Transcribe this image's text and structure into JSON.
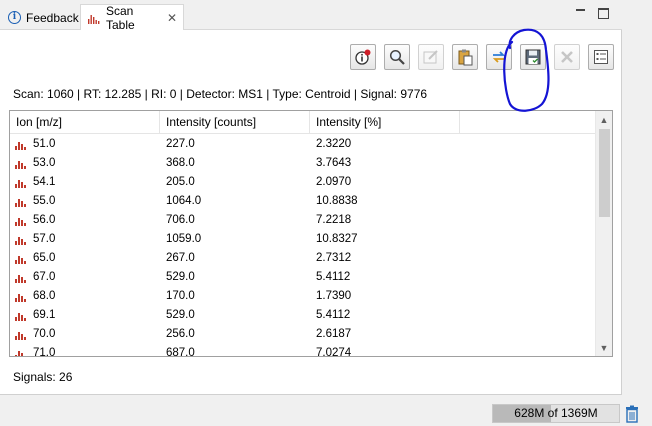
{
  "tabs": [
    {
      "label": "Feedback",
      "icon": "info-icon",
      "active": false
    },
    {
      "label": "Scan Table",
      "icon": "chart-bars-icon",
      "active": true,
      "closable": true
    }
  ],
  "window_controls": {
    "minimize_icon": "minimize-icon",
    "maximize_icon": "maximize-icon"
  },
  "toolbar": [
    {
      "name": "info-button",
      "icon": "info-badge-icon",
      "enabled": true
    },
    {
      "name": "search-button",
      "icon": "magnifier-icon",
      "enabled": true
    },
    {
      "name": "edit-button",
      "icon": "pencil-icon",
      "enabled": false
    },
    {
      "name": "paste-button",
      "icon": "clipboard-icon",
      "enabled": true
    },
    {
      "name": "sync-button",
      "icon": "swap-arrows-icon",
      "enabled": true
    },
    {
      "name": "save-button",
      "icon": "floppy-disk-icon",
      "enabled": true
    },
    {
      "name": "delete-button",
      "icon": "x-icon",
      "enabled": false
    },
    {
      "name": "list-button",
      "icon": "list-icon",
      "enabled": true
    }
  ],
  "scan_info": "Scan: 1060 | RT: 12.285 | RI: 0 | Detector: MS1 | Type: Centroid | Signal: 9776",
  "table": {
    "columns": [
      "Ion [m/z]",
      "Intensity [counts]",
      "Intensity [%]",
      ""
    ],
    "rows": [
      [
        "51.0",
        "227.0",
        "2.3220"
      ],
      [
        "53.0",
        "368.0",
        "3.7643"
      ],
      [
        "54.1",
        "205.0",
        "2.0970"
      ],
      [
        "55.0",
        "1064.0",
        "10.8838"
      ],
      [
        "56.0",
        "706.0",
        "7.2218"
      ],
      [
        "57.0",
        "1059.0",
        "10.8327"
      ],
      [
        "65.0",
        "267.0",
        "2.7312"
      ],
      [
        "67.0",
        "529.0",
        "5.4112"
      ],
      [
        "68.0",
        "170.0",
        "1.7390"
      ],
      [
        "69.1",
        "529.0",
        "5.4112"
      ],
      [
        "70.0",
        "256.0",
        "2.6187"
      ],
      [
        "71.0",
        "687.0",
        "7.0274"
      ]
    ],
    "row_icon": "spectrum-bars-icon",
    "scroll_position": 0.0
  },
  "signals_label": "Signals: 26",
  "status": {
    "memory_text": "628M of 1369M",
    "memory_used_fraction": 0.4587,
    "trash_icon": "trash-icon"
  },
  "colors": {
    "accent": "#1a5fb4",
    "annotation": "#1414d4",
    "spectrum": "#c0392b"
  }
}
